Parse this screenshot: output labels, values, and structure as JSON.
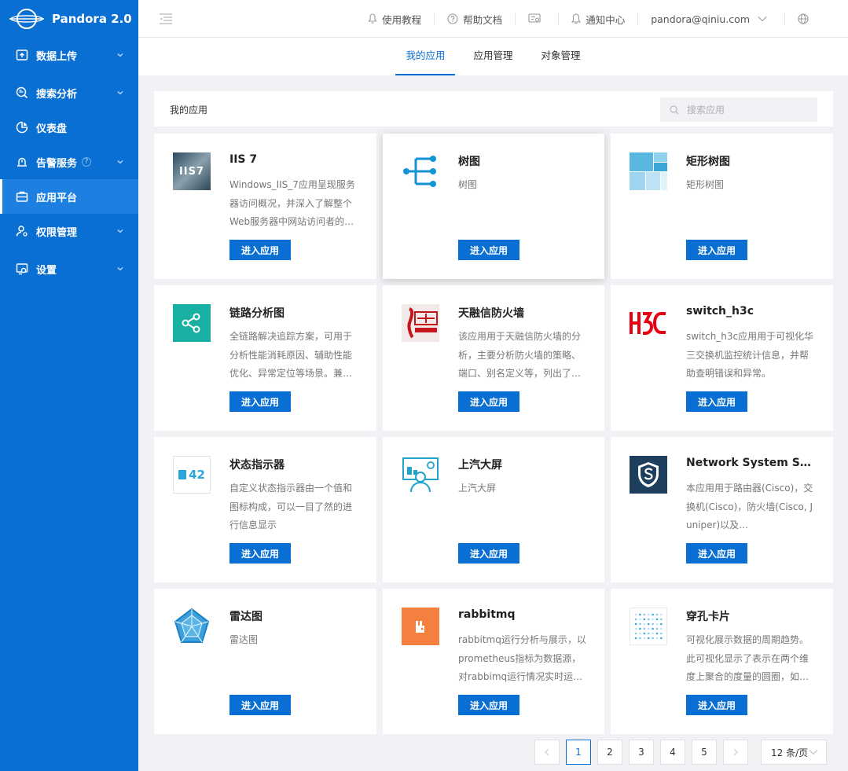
{
  "brand": {
    "name": "Pandora 2.0"
  },
  "sidebar": {
    "items": [
      {
        "label": "数据上传",
        "icon": "upload-icon",
        "has_arrow": true
      },
      {
        "label": "搜索分析",
        "icon": "search-analysis-icon",
        "has_arrow": true
      },
      {
        "label": "仪表盘",
        "icon": "dashboard-icon",
        "has_arrow": false
      },
      {
        "label": "告警服务",
        "icon": "alarm-icon",
        "has_arrow": true,
        "badge": "?"
      },
      {
        "label": "应用平台",
        "icon": "app-platform-icon",
        "has_arrow": false,
        "active": true
      },
      {
        "label": "权限管理",
        "icon": "permission-icon",
        "has_arrow": true
      },
      {
        "label": "设置",
        "icon": "settings-icon",
        "has_arrow": true
      }
    ]
  },
  "header": {
    "tutorial": "使用教程",
    "help_docs": "帮助文档",
    "notifications": "通知中心",
    "user": "pandora@qiniu.com"
  },
  "tabs": [
    {
      "label": "我的应用",
      "active": true
    },
    {
      "label": "应用管理",
      "active": false
    },
    {
      "label": "对象管理",
      "active": false
    }
  ],
  "panel": {
    "title": "我的应用",
    "search_placeholder": "搜索应用"
  },
  "apps": [
    {
      "name": "IIS 7",
      "desc": "Windows_IIS_7应用呈现服务器访问概况，并深入了解整个Web服务器中网站访问者的…",
      "button": "进入应用",
      "icon": "iis7-logo"
    },
    {
      "name": "树图",
      "desc": "树图",
      "button": "进入应用",
      "icon": "tree-diagram-icon"
    },
    {
      "name": "矩形树图",
      "desc": "矩形树图",
      "button": "进入应用",
      "icon": "treemap-icon"
    },
    {
      "name": "链路分析图",
      "desc": "全链路解决追踪方案，可用于分析性能消耗原因、辅助性能优化、异常定位等场景。兼…",
      "button": "进入应用",
      "icon": "link-analysis-icon"
    },
    {
      "name": "天融信防火墙",
      "desc": "该应用用于天融信防火墙的分析，主要分析防火墙的策略、端口、别名定义等，列出了…",
      "button": "进入应用",
      "icon": "topsec-logo"
    },
    {
      "name": "switch_h3c",
      "desc": "switch_h3c应用用于可视化华三交换机监控统计信息，并帮助查明错误和异常。",
      "button": "进入应用",
      "icon": "h3c-logo"
    },
    {
      "name": "状态指示器",
      "desc": "自定义状态指示器由一个值和图标构成，可以一目了然的进行信息显示",
      "button": "进入应用",
      "icon": "status-indicator-icon",
      "icon_value": "42"
    },
    {
      "name": "上汽大屏",
      "desc": "上汽大屏",
      "button": "进入应用",
      "icon": "big-screen-icon"
    },
    {
      "name": "Network System Secu…",
      "desc": "本应用用于路由器(Cisco)，交换机(Cisco)，防火墙(Cisco, Juniper)以及…",
      "button": "进入应用",
      "icon": "network-security-shield-icon"
    },
    {
      "name": "雷达图",
      "desc": "雷达图",
      "button": "进入应用",
      "icon": "radar-chart-icon"
    },
    {
      "name": "rabbitmq",
      "desc": "rabbitmq运行分析与展示，以prometheus指标为数据源，对rabbimq运行情况实时运…",
      "button": "进入应用",
      "icon": "rabbitmq-logo"
    },
    {
      "name": "穿孔卡片",
      "desc": "可视化展示数据的周期趋势。此可视化显示了表示在两个维度上聚合的度量的圆圈，如…",
      "button": "进入应用",
      "icon": "punch-card-icon"
    }
  ],
  "pagination": {
    "pages": [
      "1",
      "2",
      "3",
      "4",
      "5"
    ],
    "current": "1",
    "page_size": "12 条/页"
  },
  "colors": {
    "primary": "#0a6fd3",
    "sidebar_bg": "#0a6fd3"
  }
}
